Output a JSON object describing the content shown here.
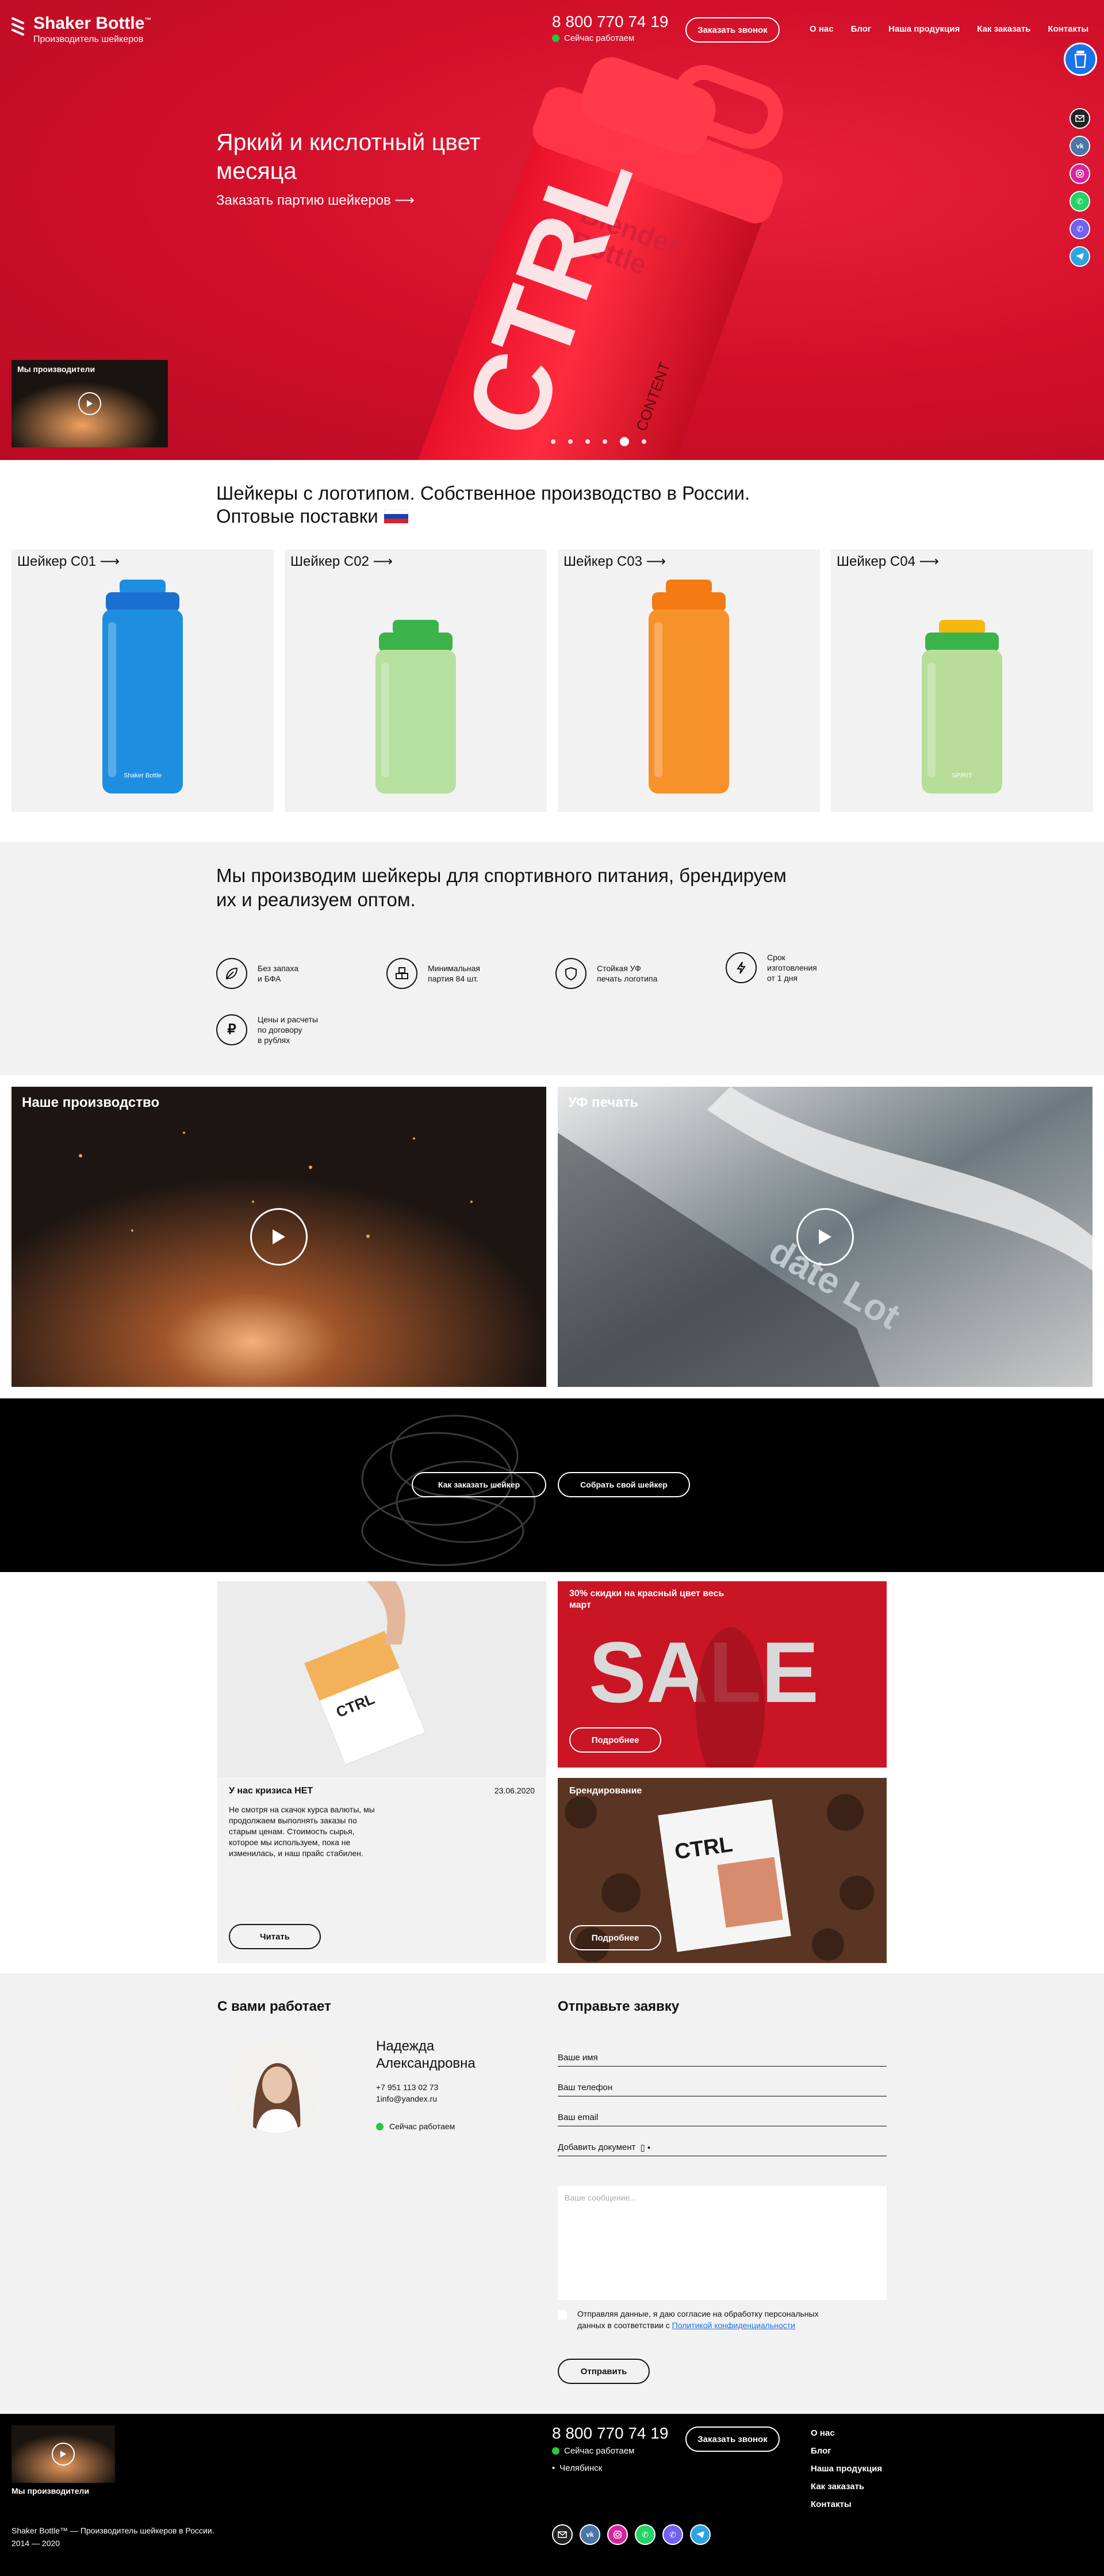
{
  "header": {
    "brand": "Shaker Bottle",
    "brand_tm": "™",
    "tagline": "Производитель шейкеров",
    "phone": "8 800 770 74 19",
    "status": "Сейчас работаем",
    "call_button": "Заказать звонок",
    "nav": [
      "О нас",
      "Блог",
      "Наша продукция",
      "Как заказать",
      "Контакты"
    ]
  },
  "hero": {
    "title": "Яркий и кислотный цвет месяца",
    "link": "Заказать партию шейкеров ⟶",
    "video_card": "Мы производители",
    "bottle_text": [
      "Blender",
      "Bottle",
      "CTRL",
      "CONTENT"
    ],
    "slides": 6,
    "active_slide": 4
  },
  "social": [
    "mail-icon",
    "vk-icon",
    "instagram-icon",
    "phone-icon",
    "viber-icon",
    "telegram-icon"
  ],
  "intro": {
    "line1": "Шейкеры с логотипом. Собственное производство в России.",
    "line2": "Оптовые поставки"
  },
  "products": [
    {
      "label": "Шейкер С01 ⟶",
      "color": "#1e8fe0",
      "cap": "#1e8fe0",
      "lid": "#1b6fd0",
      "print": "Shaker Bottle"
    },
    {
      "label": "Шейкер С02 ⟶",
      "color": "#b5e0a0",
      "cap": "#3cb34a",
      "lid": "#3cb34a",
      "print": ""
    },
    {
      "label": "Шейкер С03 ⟶",
      "color": "#f7922b",
      "cap": "#f47a14",
      "lid": "#f47a14",
      "print": ""
    },
    {
      "label": "Шейкер С04 ⟶",
      "color": "#b7dd99",
      "cap": "#f6b710",
      "lid": "#3cb34a",
      "print": "SPIRIT"
    }
  ],
  "features": {
    "title": "Мы производим шейкеры для спортивного питания, брендируем их и реализуем оптом.",
    "items": [
      {
        "icon": "leaf-icon",
        "text": "Без запаха\nи БФА"
      },
      {
        "icon": "boxes-icon",
        "text": "Минимальная\nпартия 84 шт."
      },
      {
        "icon": "shield-icon",
        "text": "Стойкая УФ\nпечать логотипа"
      },
      {
        "icon": "bolt-icon",
        "text": "Срок\nизготовления\nот 1 дня"
      },
      {
        "icon": "ruble-icon",
        "text": "Цены и расчеты\nпо договору\nв рублях"
      }
    ]
  },
  "videos": [
    {
      "title": "Наше производство"
    },
    {
      "title": "УФ печать",
      "watermark": "date\nLot"
    }
  ],
  "band": {
    "button1": "Как заказать шейкер",
    "button2": "Собрать свой шейкер"
  },
  "news": {
    "card1": {
      "title": "У нас кризиса НЕТ",
      "date": "23.06.2020",
      "text": "Не смотря на скачок курса валюты, мы продолжаем выполнять заказы по старым ценам. Стоимость сырья, которое мы используем, пока не изменилась, и наш прайс стабилен.",
      "button": "Читать",
      "pack": "CTRL"
    },
    "sale": {
      "title": "30% скидки на красный цвет весь март",
      "big": "SALE",
      "button": "Подробнее"
    },
    "branding": {
      "title": "Брендирование",
      "button": "Подробнее",
      "pack": "CTRL"
    }
  },
  "contact": {
    "heading": "С вами работает",
    "name": "Надежда Александровна",
    "phone": "+7 951 113 02 73",
    "email": "1info@yandex.ru",
    "status": "Сейчас работаем"
  },
  "form": {
    "heading": "Отправьте заявку",
    "name_ph": "Ваше имя",
    "phone_ph": "Ваш телефон",
    "email_ph": "Ваш email",
    "attach": "Добавить документ",
    "message_ph": "Ваше сообщение...",
    "consent1": "Отправляя данные, я даю согласие на обработку персональных",
    "consent2": "данных в соответствии с",
    "consent_link": "Политикой конфиденциальности",
    "submit": "Отправить"
  },
  "footer": {
    "video_caption": "Мы производители",
    "phone": "8 800 770 74 19",
    "status": "Сейчас работаем",
    "city": "Челябинск",
    "call_button": "Заказать звонок",
    "nav": [
      "О нас",
      "Блог",
      "Наша продукция",
      "Как заказать",
      "Контакты"
    ],
    "copyright1": "Shaker Bottle™ — Производитель шейкеров в России.",
    "copyright2": "2014 — 2020"
  },
  "colors": {
    "accent": "#d3102b",
    "green": "#27c73a",
    "link": "#1a73e8"
  }
}
